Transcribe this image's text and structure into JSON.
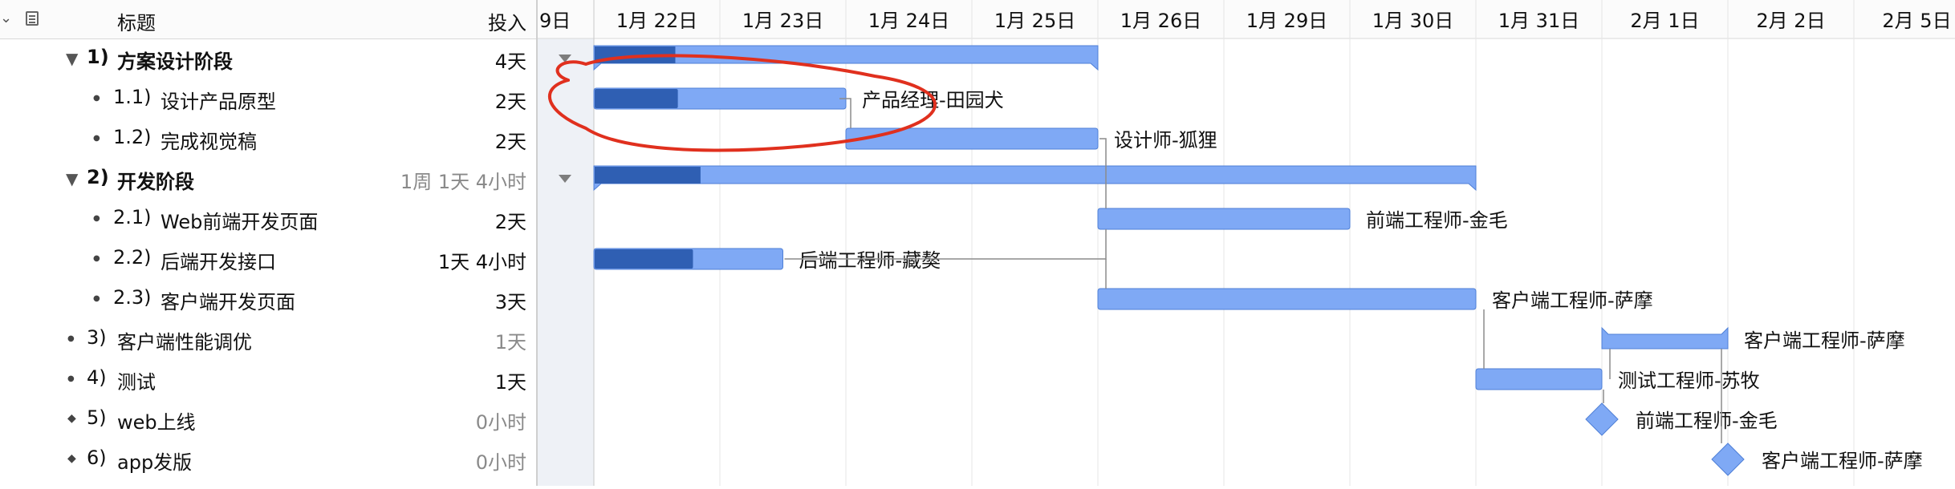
{
  "header": {
    "title": "标题",
    "effort": "投入"
  },
  "rows": [
    {
      "marker": "▼",
      "num": "1)",
      "name": "方案设计阶段",
      "effort": "4天",
      "bold": true,
      "muted": false
    },
    {
      "marker": "●",
      "num": "1.1)",
      "name": "设计产品原型",
      "effort": "2天",
      "bold": false,
      "muted": false
    },
    {
      "marker": "●",
      "num": "1.2)",
      "name": "完成视觉稿",
      "effort": "2天",
      "bold": false,
      "muted": false
    },
    {
      "marker": "▼",
      "num": "2)",
      "name": "开发阶段",
      "effort": "1周 1天 4小时",
      "bold": true,
      "muted": true
    },
    {
      "marker": "●",
      "num": "2.1)",
      "name": "Web前端开发页面",
      "effort": "2天",
      "bold": false,
      "muted": false
    },
    {
      "marker": "●",
      "num": "2.2)",
      "name": "后端开发接口",
      "effort": "1天 4小时",
      "bold": false,
      "muted": false
    },
    {
      "marker": "●",
      "num": "2.3)",
      "name": "客户端开发页面",
      "effort": "3天",
      "bold": false,
      "muted": false
    },
    {
      "marker": "●",
      "num": "3)",
      "name": "客户端性能调优",
      "effort": "1天",
      "bold": false,
      "muted": true
    },
    {
      "marker": "●",
      "num": "4)",
      "name": "测试",
      "effort": "1天",
      "bold": false,
      "muted": false
    },
    {
      "marker": "◆",
      "num": "5)",
      "name": "web上线",
      "effort": "0小时",
      "bold": false,
      "muted": true
    },
    {
      "marker": "◆",
      "num": "6)",
      "name": "app发版",
      "effort": "0小时",
      "bold": false,
      "muted": true
    }
  ],
  "timeline": {
    "partial_first_label": "9日",
    "dates": [
      "1月 22日",
      "1月 23日",
      "1月 24日",
      "1月 25日",
      "1月 26日",
      "1月 29日",
      "1月 30日",
      "1月 31日",
      "2月 1日",
      "2月 2日",
      "2月 5日"
    ]
  },
  "bars": [
    {
      "row": 0,
      "start": 0,
      "end": 4,
      "progress": 0.16,
      "summary": true,
      "label": ""
    },
    {
      "row": 1,
      "start": 0,
      "end": 2,
      "progress": 0.33,
      "summary": false,
      "label": "产品经理-田园犬"
    },
    {
      "row": 2,
      "start": 2,
      "end": 4,
      "progress": 0,
      "summary": false,
      "label": "设计师-狐狸"
    },
    {
      "row": 3,
      "start": 0,
      "end": 7,
      "progress": 0.12,
      "summary": true,
      "label": ""
    },
    {
      "row": 4,
      "start": 4,
      "end": 6,
      "progress": 0,
      "summary": false,
      "label": "前端工程师-金毛"
    },
    {
      "row": 5,
      "start": 0,
      "end": 1.5,
      "progress": 0.52,
      "summary": false,
      "label": "后端工程师-藏獒"
    },
    {
      "row": 6,
      "start": 4,
      "end": 7,
      "progress": 0,
      "summary": false,
      "label": "客户端工程师-萨摩"
    },
    {
      "row": 7,
      "start": 8,
      "end": 9,
      "progress": 0,
      "summary": false,
      "label": "客户端工程师-萨摩",
      "style": "bracket"
    },
    {
      "row": 8,
      "start": 7,
      "end": 8,
      "progress": 0,
      "summary": false,
      "label": "测试工程师-苏牧"
    }
  ],
  "milestones": [
    {
      "row": 9,
      "at": 8,
      "label": "前端工程师-金毛"
    },
    {
      "row": 10,
      "at": 9,
      "label": "客户端工程师-萨摩"
    }
  ],
  "colors": {
    "bar_fill": "#7fa9f5",
    "bar_border": "#4f7fd6",
    "bar_progress": "#2f5fb3",
    "connector": "#8c8c8c",
    "weekend_shade": "#eef1f6",
    "annotation": "#e0301e"
  }
}
